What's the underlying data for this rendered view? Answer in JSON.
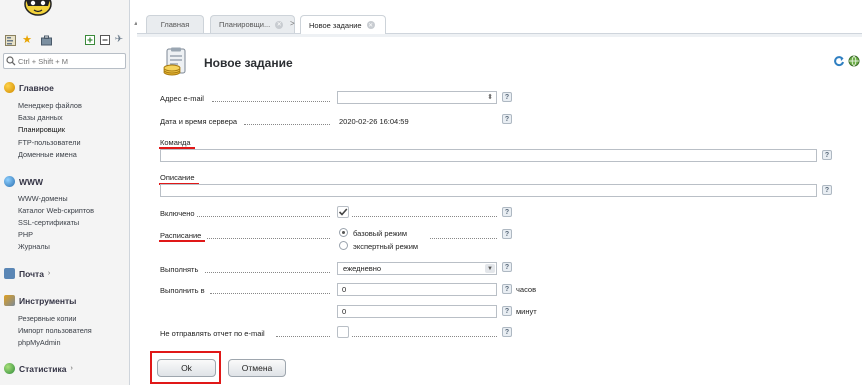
{
  "sidebar": {
    "search_placeholder": "Ctrl + Shift + M",
    "sections": [
      {
        "title": "Главное",
        "items": [
          "Менеджер файлов",
          "Базы данных",
          "Планировщик",
          "FTP-пользователи",
          "Доменные имена"
        ]
      },
      {
        "title": "WWW",
        "items": [
          "WWW-домены",
          "Каталог Web-скриптов",
          "SSL-сертификаты",
          "PHP",
          "Журналы"
        ]
      },
      {
        "title": "Почта"
      },
      {
        "title": "Инструменты",
        "items": [
          "Резервные копии",
          "Импорт пользователя",
          "phpMyAdmin"
        ]
      },
      {
        "title": "Статистика"
      }
    ],
    "collapsed_arrow": "›"
  },
  "tabs": [
    {
      "label": "Главная"
    },
    {
      "label": "Планировщи..."
    },
    {
      "label": "Новое задание"
    }
  ],
  "tab_separator": ">",
  "page": {
    "title": "Новое задание"
  },
  "form": {
    "email_label": "Адрес e-mail",
    "server_time_label": "Дата и время сервера",
    "server_time_value": "2020-02-26 16:04:59",
    "command_label": "Команда",
    "command_value": "",
    "description_label": "Описание",
    "description_value": "",
    "enabled_label": "Включено",
    "enabled_checked": true,
    "schedule_label": "Расписание",
    "schedule_options": [
      "базовый режим",
      "экспертный режим"
    ],
    "schedule_selected": "базовый режим",
    "run_label": "Выполнять",
    "run_value": "ежедневно",
    "run_at_label": "Выполнить в",
    "hours_value": "0",
    "hours_unit": "часов",
    "minutes_value": "0",
    "minutes_unit": "минут",
    "no_report_label": "Не отправлять отчет по e-mail",
    "no_report_checked": false,
    "help_glyph": "?",
    "ok_label": "Ok",
    "cancel_label": "Отмена"
  },
  "colors": {
    "highlight": "#e01818",
    "accent": "#2f7fc1",
    "sidebar_bg": "#f4f4f4"
  },
  "icons": [
    "logo-icon",
    "tree-icon",
    "star-icon",
    "briefcase-icon",
    "expand-icon",
    "collapse-icon",
    "pin-icon",
    "search-icon",
    "home-icon",
    "globe-icon",
    "mail-icon",
    "tools-icon",
    "stats-icon",
    "scheduler-icon",
    "refresh-icon",
    "globe-small-icon",
    "checkmark-icon"
  ]
}
